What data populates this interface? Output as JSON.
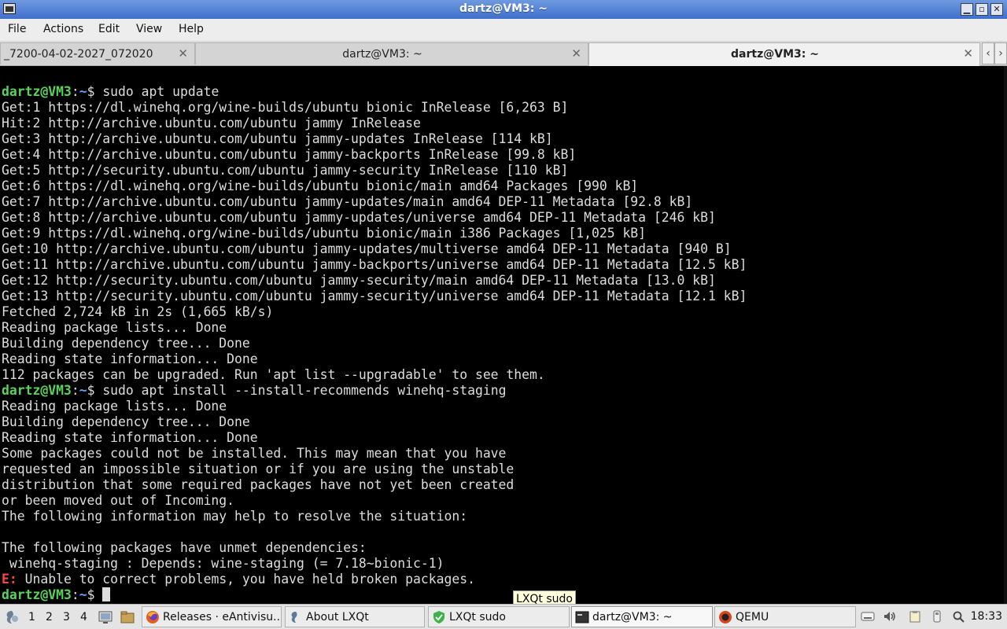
{
  "window": {
    "title": "dartz@VM3: ~"
  },
  "menu": [
    "File",
    "Actions",
    "Edit",
    "View",
    "Help"
  ],
  "tabs": [
    {
      "label": "_7200-04-02-2027_072020",
      "active": false
    },
    {
      "label": "dartz@VM3: ~",
      "active": false
    },
    {
      "label": "dartz@VM3: ~",
      "active": true
    }
  ],
  "prompt": {
    "user": "dartz@VM3",
    "path": "~"
  },
  "terminal": {
    "cmd1": "sudo apt update",
    "output1": [
      "Get:1 https://dl.winehq.org/wine-builds/ubuntu bionic InRelease [6,263 B]",
      "Hit:2 http://archive.ubuntu.com/ubuntu jammy InRelease",
      "Get:3 http://archive.ubuntu.com/ubuntu jammy-updates InRelease [114 kB]",
      "Get:4 http://archive.ubuntu.com/ubuntu jammy-backports InRelease [99.8 kB]",
      "Get:5 http://security.ubuntu.com/ubuntu jammy-security InRelease [110 kB]",
      "Get:6 https://dl.winehq.org/wine-builds/ubuntu bionic/main amd64 Packages [990 kB]",
      "Get:7 http://archive.ubuntu.com/ubuntu jammy-updates/main amd64 DEP-11 Metadata [92.8 kB]",
      "Get:8 http://archive.ubuntu.com/ubuntu jammy-updates/universe amd64 DEP-11 Metadata [246 kB]",
      "Get:9 https://dl.winehq.org/wine-builds/ubuntu bionic/main i386 Packages [1,025 kB]",
      "Get:10 http://archive.ubuntu.com/ubuntu jammy-updates/multiverse amd64 DEP-11 Metadata [940 B]",
      "Get:11 http://archive.ubuntu.com/ubuntu jammy-backports/universe amd64 DEP-11 Metadata [12.5 kB]",
      "Get:12 http://security.ubuntu.com/ubuntu jammy-security/main amd64 DEP-11 Metadata [13.0 kB]",
      "Get:13 http://security.ubuntu.com/ubuntu jammy-security/universe amd64 DEP-11 Metadata [12.1 kB]",
      "Fetched 2,724 kB in 2s (1,665 kB/s)",
      "Reading package lists... Done",
      "Building dependency tree... Done",
      "Reading state information... Done",
      "112 packages can be upgraded. Run 'apt list --upgradable' to see them."
    ],
    "cmd2": "sudo apt install --install-recommends winehq-staging",
    "output2": [
      "Reading package lists... Done",
      "Building dependency tree... Done",
      "Reading state information... Done",
      "Some packages could not be installed. This may mean that you have",
      "requested an impossible situation or if you are using the unstable",
      "distribution that some required packages have not yet been created",
      "or been moved out of Incoming.",
      "The following information may help to resolve the situation:",
      "",
      "The following packages have unmet dependencies:",
      " winehq-staging : Depends: wine-staging (= 7.18~bionic-1)"
    ],
    "error_prefix": "E:",
    "error_text": " Unable to correct problems, you have held broken packages."
  },
  "tooltip": "LXQt sudo",
  "taskbar": {
    "desktops": [
      "1",
      "2",
      "3",
      "4"
    ],
    "tasks": [
      {
        "label": "Releases · eAntivisu...",
        "icon": "firefox-icon",
        "active": false
      },
      {
        "label": "About LXQt",
        "icon": "lxqt-icon",
        "active": false
      },
      {
        "label": "LXQt sudo",
        "icon": "shield-icon",
        "active": false
      },
      {
        "label": "dartz@VM3: ~",
        "icon": "terminal-icon",
        "active": true
      },
      {
        "label": "QEMU",
        "icon": "qemu-icon",
        "active": false
      }
    ],
    "clock": "18:33"
  },
  "colors": {
    "prompt_user": "#5bd35b",
    "prompt_path": "#5ca6ff",
    "error": "#ff4444",
    "titlebar": "#4a78d0"
  }
}
